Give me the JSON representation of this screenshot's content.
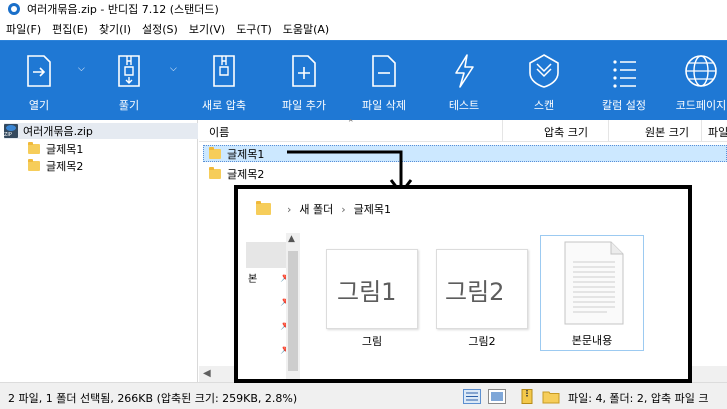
{
  "window": {
    "title": "여러개묶음.zip - 반디집 7.12 (스탠더드)"
  },
  "menu": [
    "파일(F)",
    "편집(E)",
    "찾기(I)",
    "설정(S)",
    "보기(V)",
    "도구(T)",
    "도움말(A)"
  ],
  "toolbar": {
    "open": "열기",
    "extract": "풀기",
    "new_archive": "새로 압축",
    "add_file": "파일 추가",
    "delete_file": "파일 삭제",
    "test": "테스트",
    "scan": "스캔",
    "column_settings": "칼럼 설정",
    "codepage": "코드페이지"
  },
  "tree": {
    "root": "여러개묶음.zip",
    "items": [
      "글제목1",
      "글제목2"
    ]
  },
  "list": {
    "columns": {
      "name": "이름",
      "compressed": "압축 크기",
      "original": "원본 크기",
      "file": "파일"
    },
    "rows": [
      {
        "name": "글제목1",
        "selected": true
      },
      {
        "name": "글제목2",
        "selected": false
      }
    ]
  },
  "overlay": {
    "breadcrumb": [
      "새 폴더",
      "글제목1"
    ],
    "side_char": "본",
    "items": [
      {
        "label": "그림",
        "sketch": "그림1"
      },
      {
        "label": "그림2",
        "sketch": "그림2"
      },
      {
        "label": "본문내용"
      }
    ]
  },
  "status": {
    "left": "2 파일, 1 폴더 선택됨, 266KB (압축된 크기: 259KB, 2.8%)",
    "right": "파일: 4, 폴더: 2, 압축 파일 크"
  },
  "colors": {
    "toolbar": "#1f78d4",
    "selection": "#cce8ff",
    "folder": "#f6cd5a"
  }
}
